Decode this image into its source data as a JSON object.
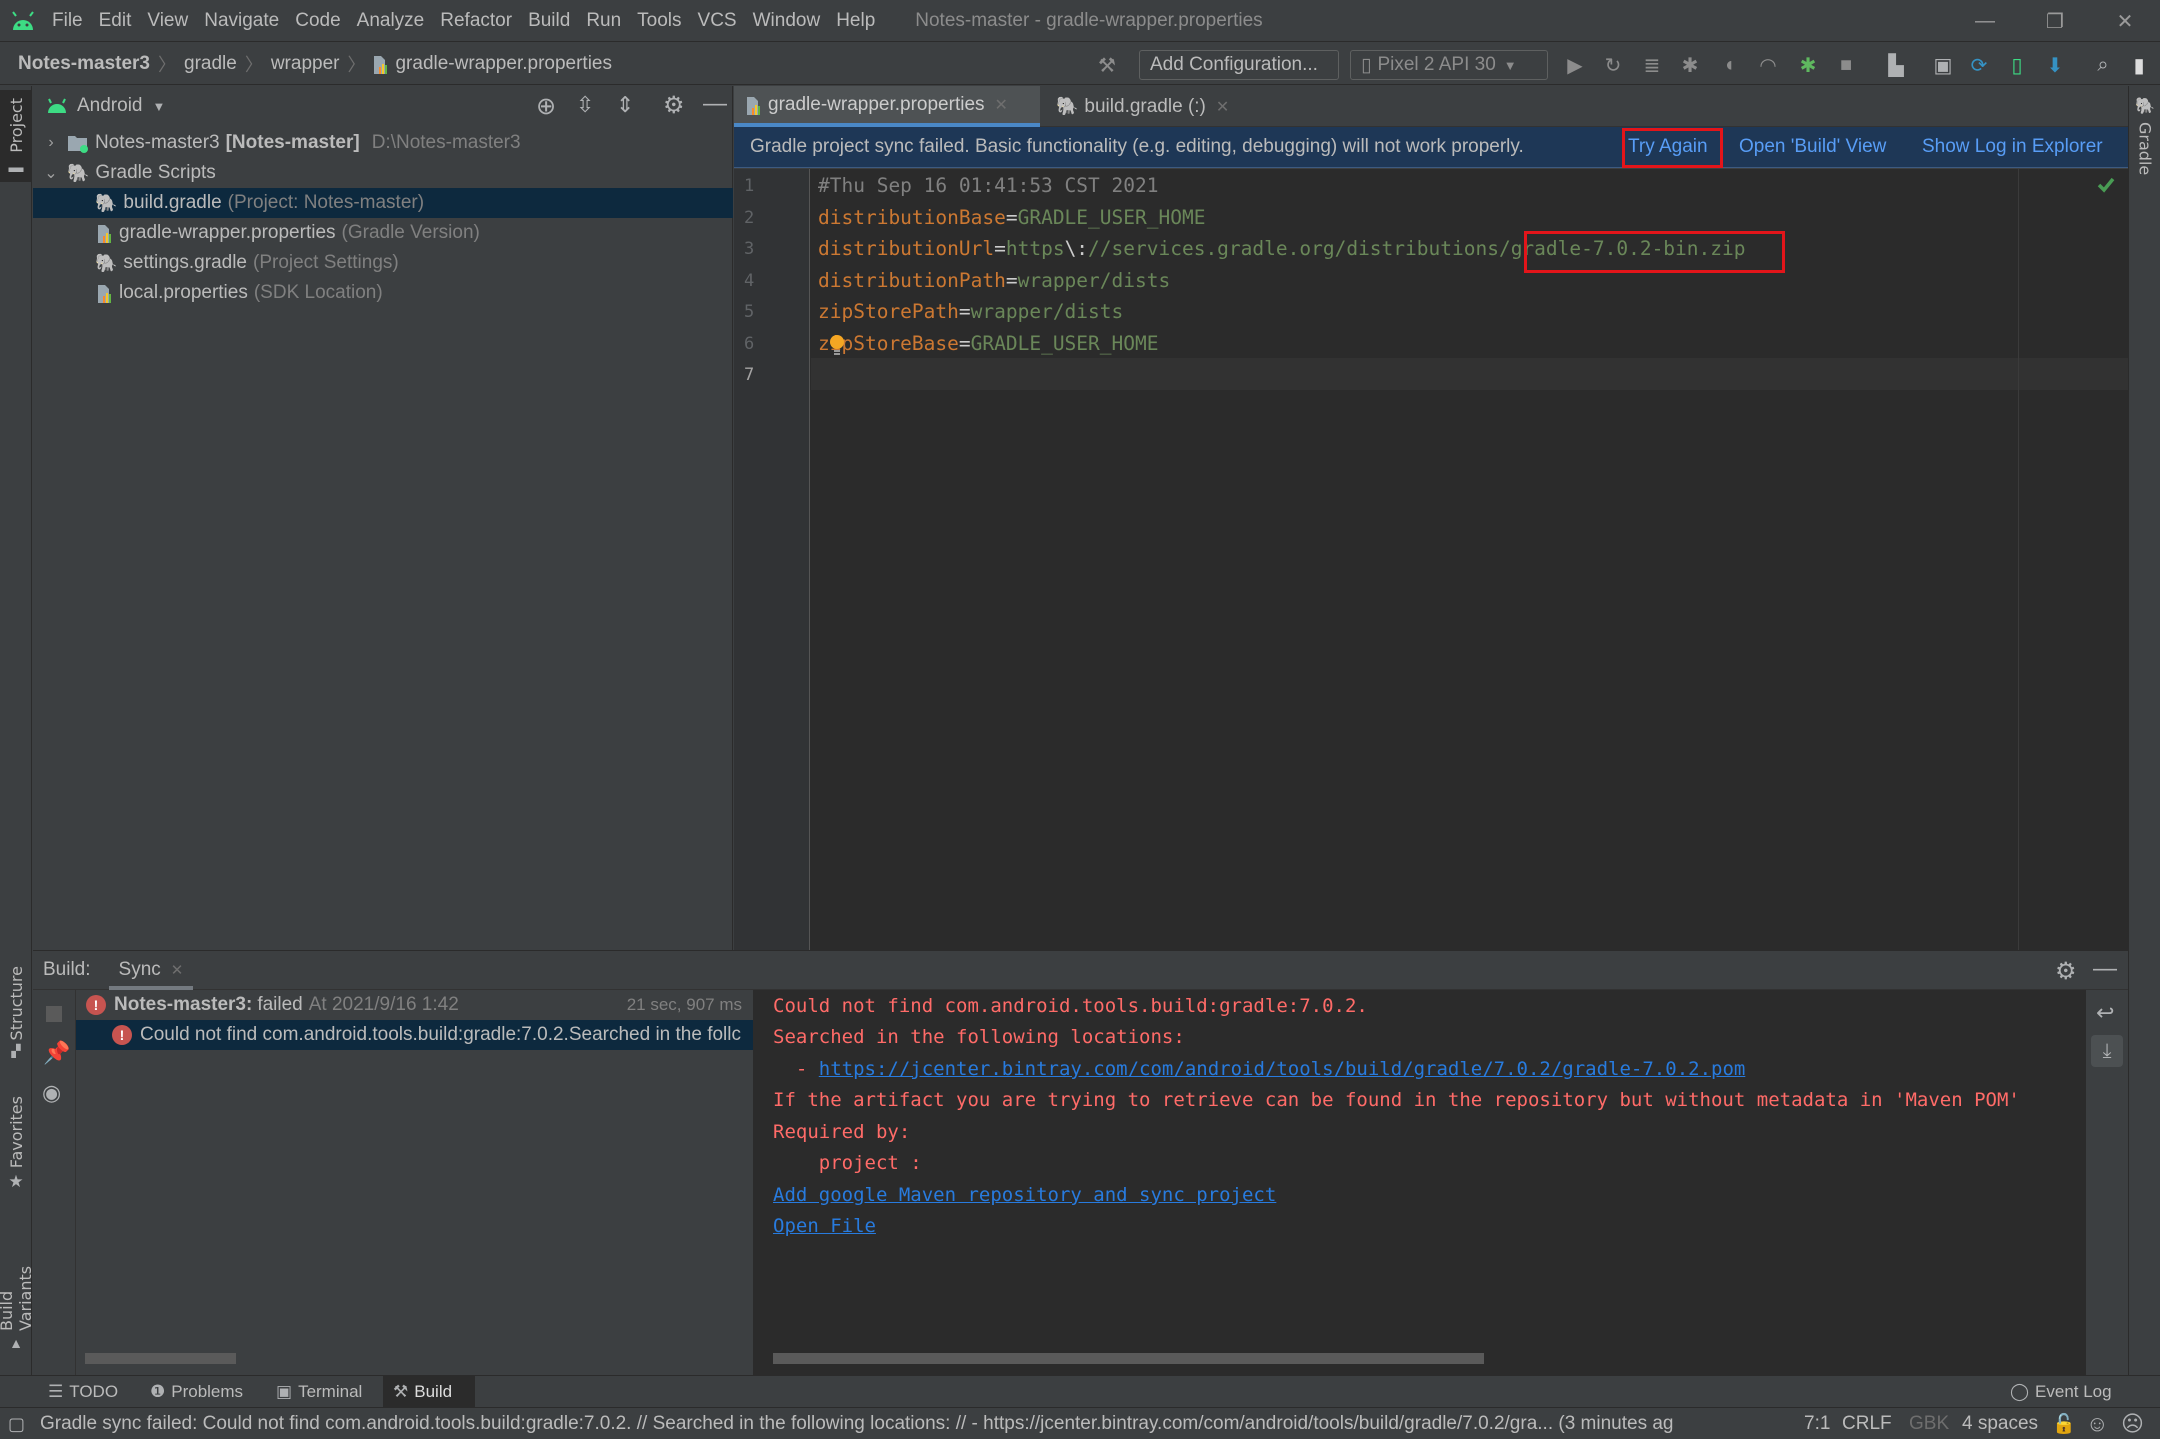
{
  "titlebar": {
    "menu": [
      "File",
      "Edit",
      "View",
      "Navigate",
      "Code",
      "Analyze",
      "Refactor",
      "Build",
      "Run",
      "Tools",
      "VCS",
      "Window",
      "Help"
    ],
    "menu_mnemonics": [
      "F",
      "E",
      "V",
      "N",
      "C",
      "",
      "R",
      "B",
      "u",
      "T",
      "",
      "W",
      "H"
    ],
    "window_title": "Notes-master - gradle-wrapper.properties",
    "controls": {
      "minimize": "—",
      "restore": "❐",
      "close": "✕"
    }
  },
  "navbar": {
    "breadcrumb": [
      "Notes-master3",
      "gradle",
      "wrapper",
      "gradle-wrapper.properties"
    ],
    "add_configuration": "Add Configuration...",
    "device": "Pixel 2 API 30"
  },
  "left_strip": {
    "tabs": [
      "Project",
      "Structure",
      "Favorites",
      "Build Variants"
    ]
  },
  "right_strip": {
    "tabs": [
      "Gradle"
    ]
  },
  "project_panel": {
    "view_mode": "Android",
    "tree": [
      {
        "label": "Notes-master3",
        "bold": "[Notes-master]",
        "hint": "D:\\Notes-master3",
        "expanded": false,
        "icon": "module-folder-icon"
      },
      {
        "label": "Gradle Scripts",
        "hint": "",
        "expanded": true,
        "icon": "gradle-elephant-icon"
      },
      {
        "label": "build.gradle",
        "hint": "(Project: Notes-master)",
        "icon": "gradle-elephant-icon",
        "selected": true
      },
      {
        "label": "gradle-wrapper.properties",
        "hint": "(Gradle Version)",
        "icon": "properties-file-icon"
      },
      {
        "label": "settings.gradle",
        "hint": "(Project Settings)",
        "icon": "gradle-elephant-icon"
      },
      {
        "label": "local.properties",
        "hint": "(SDK Location)",
        "icon": "properties-file-icon"
      }
    ]
  },
  "editor": {
    "tabs": [
      {
        "label": "gradle-wrapper.properties",
        "active": true
      },
      {
        "label": "build.gradle (:)",
        "active": false
      }
    ],
    "banner": {
      "message": "Gradle project sync failed. Basic functionality (e.g. editing, debugging) will not work properly.",
      "actions": [
        "Try Again",
        "Open 'Build' View",
        "Show Log in Explorer"
      ]
    },
    "lines": [
      {
        "n": "1",
        "comment": "#Thu Sep 16 01:41:53 CST 2021"
      },
      {
        "n": "2",
        "key": "distributionBase",
        "value": "GRADLE_USER_HOME"
      },
      {
        "n": "3",
        "key": "distributionUrl",
        "value_prefix": "https",
        "escape": "\\:",
        "value_mid": "//services.gradle.org/distributions/",
        "value_highlight": "gradle-7.0.2-bin.zip"
      },
      {
        "n": "4",
        "key": "distributionPath",
        "value": "wrapper/dists"
      },
      {
        "n": "5",
        "key": "zipStorePath",
        "value": "wrapper/dists"
      },
      {
        "n": "6",
        "key": "zipStoreBase",
        "value": "GRADLE_USER_HOME"
      },
      {
        "n": "7"
      }
    ]
  },
  "build_panel": {
    "label": "Build:",
    "tab": "Sync",
    "tree": [
      {
        "title": "Notes-master3:",
        "status": "failed",
        "time": "At 2021/9/16 1:42",
        "duration": "21 sec, 907 ms"
      },
      {
        "message": "Could not find com.android.tools.build:gradle:7.0.2.Searched in the follc"
      }
    ],
    "console": [
      {
        "text": "Could not find com.android.tools.build:gradle:7.0.2."
      },
      {
        "text": "Searched in the following locations:"
      },
      {
        "prefix": "  - ",
        "link": "https://jcenter.bintray.com/com/android/tools/build/gradle/7.0.2/gradle-7.0.2.pom"
      },
      {
        "text": "If the artifact you are trying to retrieve can be found in the repository but without metadata in 'Maven POM'"
      },
      {
        "text": "Required by:"
      },
      {
        "text": "    project :"
      },
      {
        "link": "Add google Maven repository and sync project"
      },
      {
        "link": "Open File"
      }
    ]
  },
  "bottom_tabs": [
    {
      "label": "TODO",
      "active": false
    },
    {
      "label": "Problems",
      "active": false
    },
    {
      "label": "Terminal",
      "active": false
    },
    {
      "label": "Build",
      "active": true
    }
  ],
  "event_log": "Event Log",
  "statusbar": {
    "message": "Gradle sync failed: Could not find com.android.tools.build:gradle:7.0.2. // Searched in the following locations: //  - https://jcenter.bintray.com/com/android/tools/build/gradle/7.0.2/gra... (3 minutes ag",
    "position": "7:1",
    "line_separator": "CRLF",
    "encoding": "GBK",
    "indent": "4 spaces"
  },
  "colors": {
    "accent": "#4a88c7",
    "error": "#ff6b68",
    "link": "#287bde",
    "highlight_box": "#e3151a",
    "android_green": "#3ddc84"
  }
}
